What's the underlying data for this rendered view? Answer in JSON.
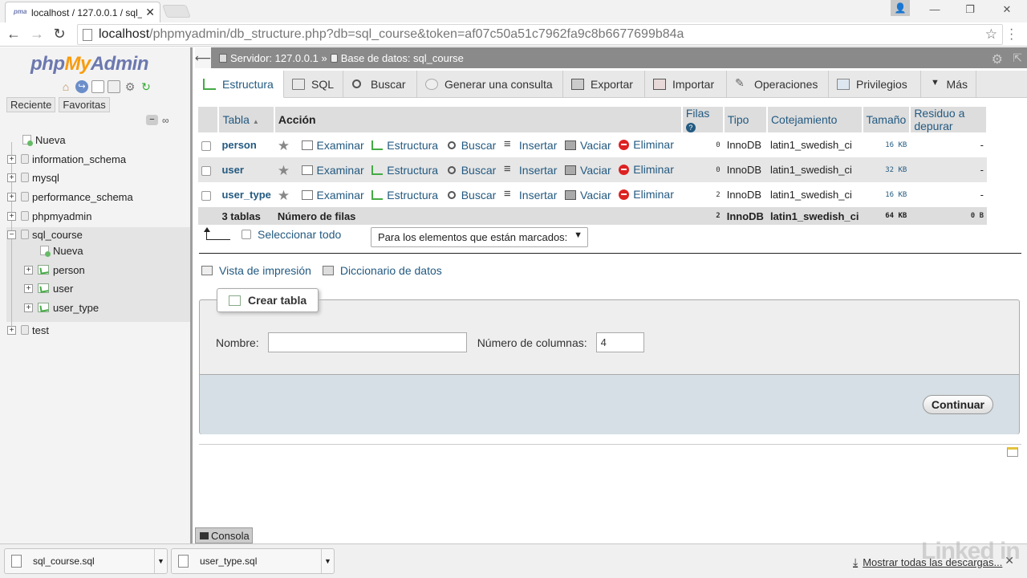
{
  "browser": {
    "tab_title": "localhost / 127.0.0.1 / sql_",
    "tab_close": "✕",
    "url_host": "localhost",
    "url_path": "/phpmyadmin/db_structure.php?db=sql_course&token=af07c50a51c7962fa9c8b6677699b84a",
    "back": "←",
    "forward": "→",
    "reload": "↻",
    "star": "☆",
    "win_min": "—",
    "win_max": "❐",
    "win_close": "✕",
    "user_icon": "👤"
  },
  "sidebar": {
    "logo_php": "php",
    "logo_my": "My",
    "logo_admin": "Admin",
    "recent_label": "Reciente",
    "favorites_label": "Favoritas",
    "collapse_icon": "−",
    "link_icon": "∞",
    "tree": [
      {
        "label": "Nueva"
      },
      {
        "label": "information_schema"
      },
      {
        "label": "mysql"
      },
      {
        "label": "performance_schema"
      },
      {
        "label": "phpmyadmin"
      },
      {
        "label": "sql_course"
      },
      {
        "label": "Nueva"
      },
      {
        "label": "person"
      },
      {
        "label": "user"
      },
      {
        "label": "user_type"
      },
      {
        "label": "test"
      }
    ]
  },
  "breadcrumb": {
    "server": "Servidor: 127.0.0.1 »",
    "database": "Base de datos: sql_course",
    "back_icon": "⟵",
    "gear_icon": "⚙",
    "collapse_icon": "⇱"
  },
  "tabs": [
    {
      "label": "Estructura"
    },
    {
      "label": "SQL"
    },
    {
      "label": "Buscar"
    },
    {
      "label": "Generar una consulta"
    },
    {
      "label": "Exportar"
    },
    {
      "label": "Importar"
    },
    {
      "label": "Operaciones"
    },
    {
      "label": "Privilegios"
    },
    {
      "label": "Más"
    }
  ],
  "table": {
    "headers": {
      "tabla": "Tabla",
      "sort_icon": "▲",
      "accion": "Acción",
      "filas": "Filas",
      "help": "?",
      "tipo": "Tipo",
      "cotejamiento": "Cotejamiento",
      "tamano": "Tamaño",
      "residuo": "Residuo a depurar"
    },
    "actions": {
      "star": "★",
      "examinar": "Examinar",
      "estructura": "Estructura",
      "buscar": "Buscar",
      "insertar": "Insertar",
      "vaciar": "Vaciar",
      "eliminar": "Eliminar"
    },
    "rows": [
      {
        "name": "person",
        "rows": "0",
        "type": "InnoDB",
        "collation": "latin1_swedish_ci",
        "size": "16 KB",
        "overhead": "-"
      },
      {
        "name": "user",
        "rows": "0",
        "type": "InnoDB",
        "collation": "latin1_swedish_ci",
        "size": "32 KB",
        "overhead": "-"
      },
      {
        "name": "user_type",
        "rows": "2",
        "type": "InnoDB",
        "collation": "latin1_swedish_ci",
        "size": "16 KB",
        "overhead": "-"
      }
    ],
    "footer": {
      "count": "3 tablas",
      "label": "Número de filas",
      "rows": "2",
      "type": "InnoDB",
      "collation": "latin1_swedish_ci",
      "size": "64 KB",
      "overhead": "0 B"
    }
  },
  "selection": {
    "select_all": "Seleccionar todo",
    "with_selected": "Para los elementos que están marcados:",
    "caret": "▼"
  },
  "links": {
    "print": "Vista de impresión",
    "dictionary": "Diccionario de datos"
  },
  "create": {
    "legend": "Crear tabla",
    "name_label": "Nombre:",
    "name_value": "",
    "columns_label": "Número de columnas:",
    "columns_value": "4",
    "submit": "Continuar"
  },
  "console": {
    "label": "Consola"
  },
  "downloads": {
    "items": [
      {
        "name": "sql_course.sql"
      },
      {
        "name": "user_type.sql"
      }
    ],
    "dropdown": "▼",
    "show_all": "Mostrar todas las descargas...",
    "download_icon": "⤓",
    "close": "✕"
  },
  "watermark": "Linked in"
}
